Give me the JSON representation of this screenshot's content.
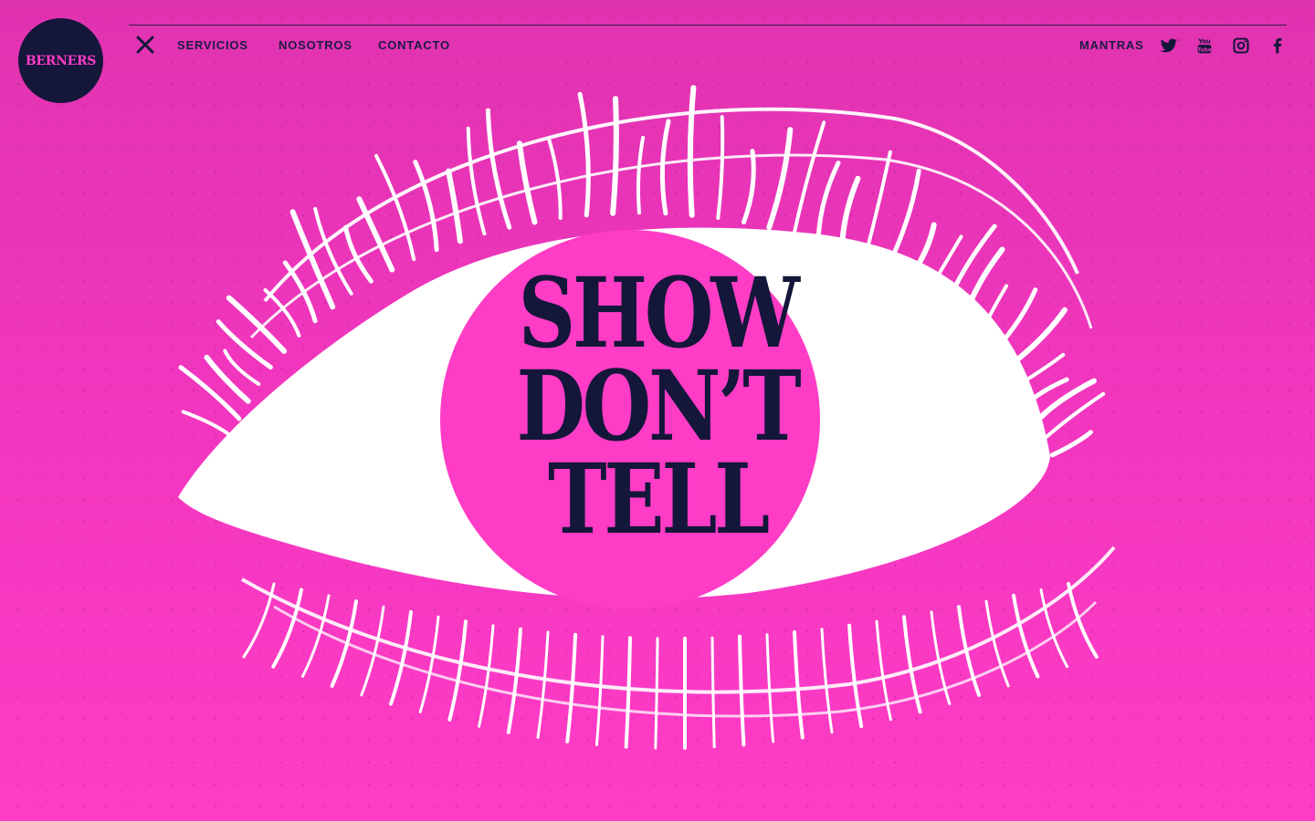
{
  "brand": {
    "logo_text": "BERNERS"
  },
  "nav": {
    "left_items": [
      "SERVICIOS",
      "NOSOTROS",
      "CONTACTO"
    ],
    "right_item": "MANTRAS"
  },
  "social_icons": [
    "twitter-icon",
    "youtube-icon",
    "instagram-icon",
    "facebook-icon"
  ],
  "hero": {
    "lines": [
      "SHOW",
      "DON’T",
      "TELL"
    ]
  },
  "colors": {
    "background": "#ff3cc6",
    "navy": "#14163a",
    "white": "#ffffff"
  }
}
